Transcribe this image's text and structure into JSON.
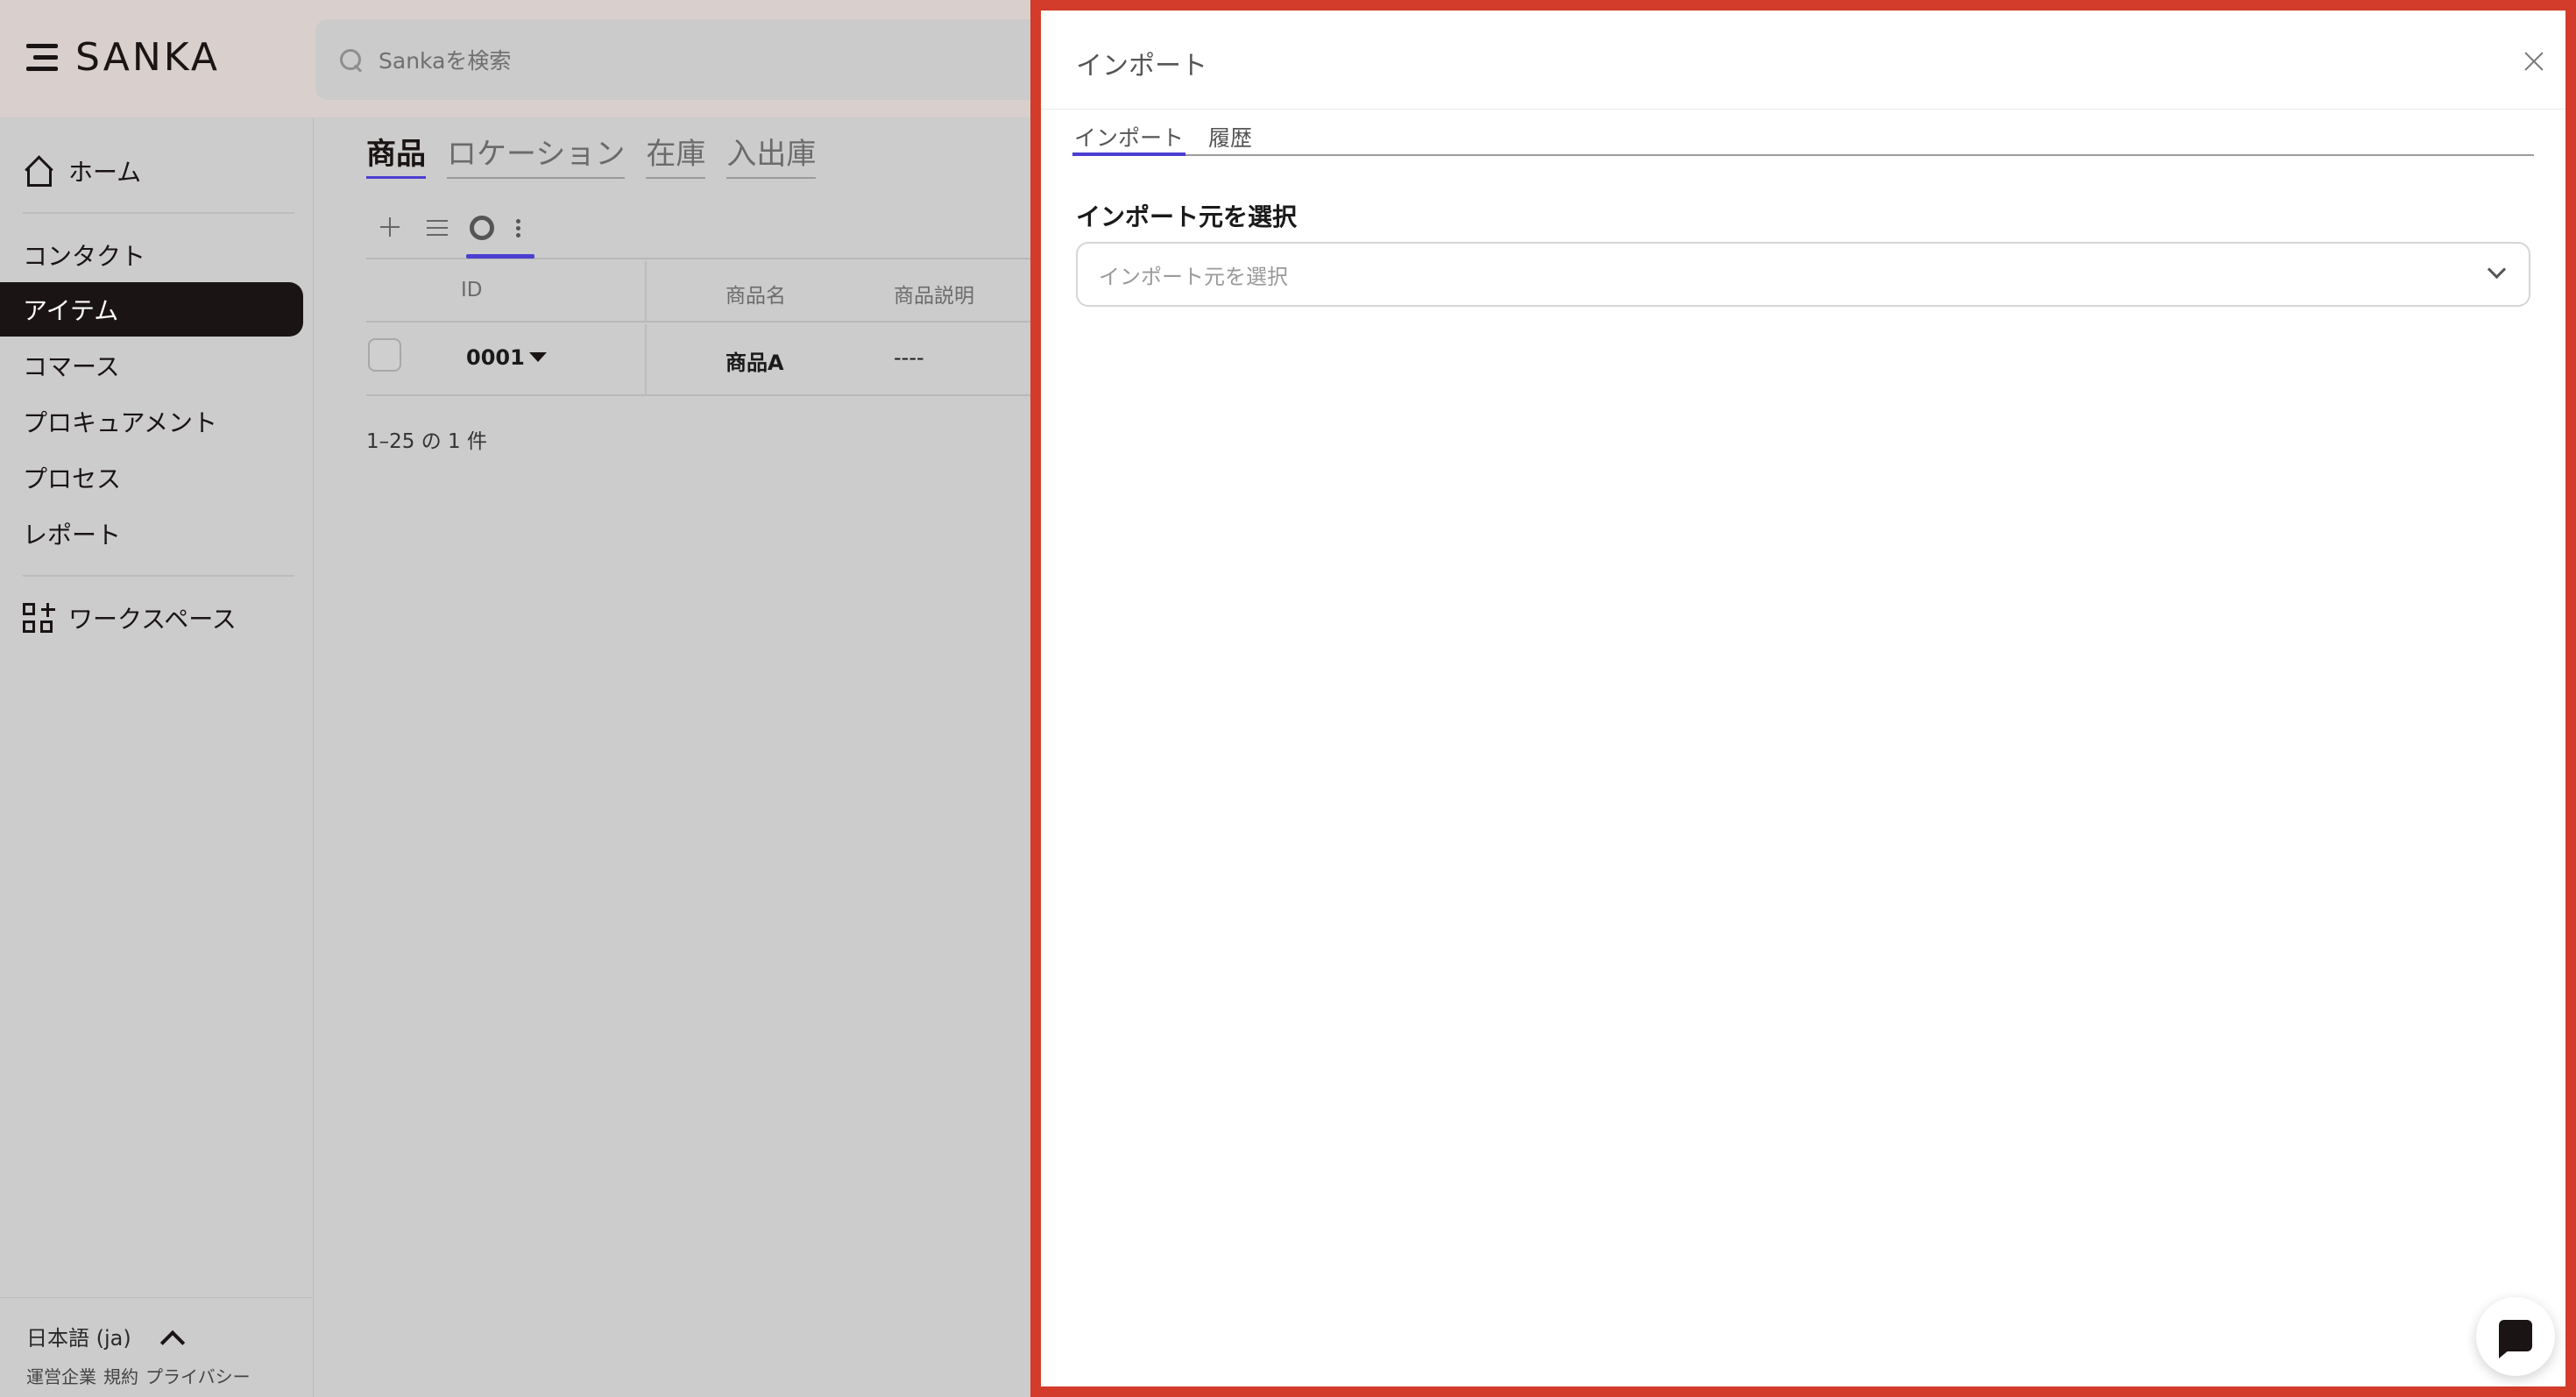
{
  "header": {
    "brand": "SANKA",
    "search_placeholder": "Sankaを検索"
  },
  "sidebar": {
    "items": [
      {
        "label": "ホーム",
        "icon": "home-icon"
      },
      {
        "label": "コンタクト"
      },
      {
        "label": "アイテム",
        "active": true
      },
      {
        "label": "コマース"
      },
      {
        "label": "プロキュアメント"
      },
      {
        "label": "プロセス"
      },
      {
        "label": "レポート"
      },
      {
        "label": "ワークスペース",
        "icon": "grid-add-icon"
      }
    ],
    "language": "日本語 (ja)",
    "footer_links": [
      "運営企業",
      "規約",
      "プライバシー"
    ]
  },
  "main": {
    "tabs": [
      "商品",
      "ロケーション",
      "在庫",
      "入出庫"
    ],
    "active_tab": "商品",
    "table": {
      "columns": [
        "ID",
        "商品名",
        "商品説明"
      ],
      "rows": [
        {
          "id": "0001",
          "name": "商品A",
          "description": "----"
        }
      ]
    },
    "pagination": "1–25 の 1 件"
  },
  "panel": {
    "title": "インポート",
    "tabs": [
      "インポート",
      "履歴"
    ],
    "active_tab": "インポート",
    "field_label": "インポート元を選択",
    "select_placeholder": "インポート元を選択"
  },
  "colors": {
    "panel_border": "#d33b2a",
    "accent": "#4b3fd1",
    "sidebar_active": "#1a1414",
    "header_bg": "#d9cfcc"
  }
}
